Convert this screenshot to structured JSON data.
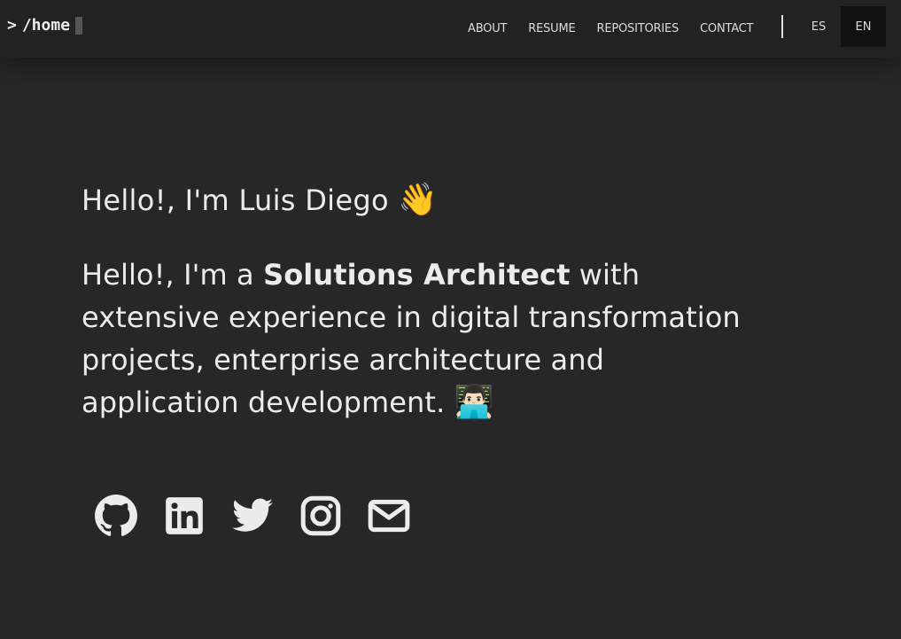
{
  "brand": {
    "prompt": ">",
    "path": "/home"
  },
  "nav": {
    "links": [
      "ABOUT",
      "RESUME",
      "REPOSITORIES",
      "CONTACT"
    ],
    "lang_es": "ES",
    "lang_en": "EN",
    "active_lang": "EN"
  },
  "hero": {
    "greeting": "Hello!, I'm Luis Diego",
    "greeting_emoji": "👋",
    "intro_prefix": "Hello!, I'm a",
    "role": "Solutions Architect",
    "intro_suffix": "with extensive experience in digital transformation projects, enterprise architecture and application development.",
    "intro_emoji": "👨🏻‍💻"
  },
  "socials": [
    "github-icon",
    "linkedin-icon",
    "twitter-icon",
    "instagram-icon",
    "envelope-icon"
  ],
  "colors": {
    "background": "#272727",
    "navbar": "#222222",
    "text": "#ececec",
    "active_lang_bg": "#111111"
  }
}
